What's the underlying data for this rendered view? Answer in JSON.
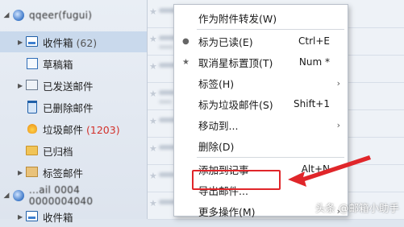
{
  "sidebar": {
    "account1": {
      "name": "qqeer(fugui)"
    },
    "folders": [
      {
        "label": "收件箱",
        "count": "(62)"
      },
      {
        "label": "草稿箱",
        "count": ""
      },
      {
        "label": "已发送邮件",
        "count": ""
      },
      {
        "label": "已删除邮件",
        "count": ""
      },
      {
        "label": "垃圾邮件",
        "count": "(1203)"
      },
      {
        "label": "已归档",
        "count": ""
      },
      {
        "label": "标签邮件",
        "count": ""
      }
    ],
    "account2": {
      "name": "...ail 0004 0000004040"
    },
    "account2_inbox": {
      "label": "收件箱"
    }
  },
  "context_menu": {
    "items": [
      {
        "label": "作为附件转发(W)",
        "shortcut": ""
      },
      {
        "label": "标为已读(E)",
        "shortcut": "Ctrl+E"
      },
      {
        "label": "取消星标置顶(T)",
        "shortcut": "Num *"
      },
      {
        "label": "标签(H)",
        "shortcut": ""
      },
      {
        "label": "标为垃圾邮件(S)",
        "shortcut": "Shift+1"
      },
      {
        "label": "移动到...",
        "shortcut": ""
      },
      {
        "label": "删除(D)",
        "shortcut": ""
      },
      {
        "label": "添加到记事",
        "shortcut": "Alt+N"
      },
      {
        "label": "导出邮件...",
        "shortcut": ""
      },
      {
        "label": "更多操作(M)",
        "shortcut": ""
      }
    ]
  },
  "annotation": {
    "color": "#e0262a"
  },
  "watermark": {
    "text": "头条 @邮箱小助手"
  },
  "colors": {
    "selected_bg": "#c9d9ec",
    "spam_count": "#d3312b"
  }
}
